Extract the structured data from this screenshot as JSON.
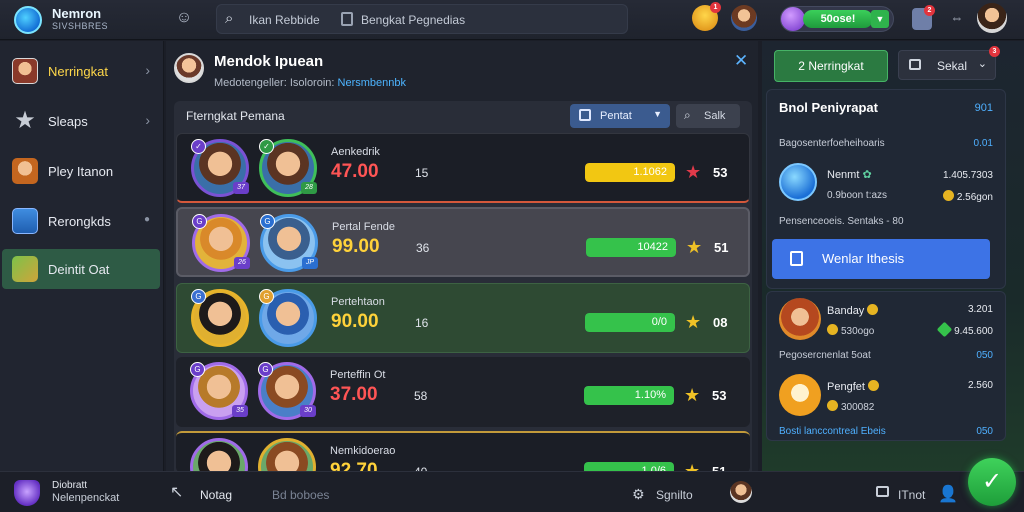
{
  "header": {
    "logo_title": "Nemron",
    "logo_subtitle": "SIVSHBRES",
    "search_label": "Ikan Rebbide",
    "search_secondary": "Bengkat Pegnedias",
    "gem_value": "50ose!",
    "badges": [
      "1",
      "2",
      "3"
    ]
  },
  "sidebar": {
    "items": [
      {
        "label": "Nerringkat",
        "icon": "hero-portrait-icon",
        "has_arrow": true
      },
      {
        "label": "Sleaps",
        "icon": "star-icon",
        "has_arrow": true
      },
      {
        "label": "Pley Itanon",
        "icon": "character-icon",
        "has_arrow": false
      },
      {
        "label": "Rerongkds",
        "icon": "screen-icon",
        "has_arrow": false
      },
      {
        "label": "Deintit Oat",
        "icon": "map-icon",
        "has_arrow": false
      }
    ]
  },
  "main": {
    "title": "Mendok Ipuean",
    "subtitle_plain": "Medotengeller: Isoloroin:",
    "subtitle_link": "Nersmbennbk",
    "panel_title": "Fterngkat Pemana",
    "filter_label": "Pentat",
    "search_label": "Salk",
    "rows": [
      {
        "label": "Aenkedrik",
        "score": "47.00",
        "num": "15",
        "bar_text": "1.1062",
        "bar_fraction": 1.0,
        "bar_color": "#f2c712",
        "star": "red-star-icon",
        "rank": "53",
        "score_color": "#ff5555"
      },
      {
        "label": "Pertal Fende",
        "score": "99.00",
        "num": "36",
        "bar_text": "10422",
        "bar_fraction": 1.0,
        "bar_color": "#35c24b",
        "star": "gold-star-icon",
        "rank": "51",
        "score_color": "#ffd23a"
      },
      {
        "label": "Pertehtaon",
        "score": "90.00",
        "num": "16",
        "bar_text": "0/0",
        "bar_fraction": 1.0,
        "bar_color": "#35c24b",
        "star": "gold-star-icon",
        "rank": "08",
        "score_color": "#ffd23a"
      },
      {
        "label": "Perteffin Ot",
        "score": "37.00",
        "num": "58",
        "bar_text": "1.10%",
        "bar_fraction": 1.0,
        "bar_color": "#35c24b",
        "star": "gold-star-icon",
        "rank": "53",
        "score_color": "#ff5555"
      },
      {
        "label": "Nemkidoerao",
        "score": "92.70",
        "num": "40",
        "bar_text": "1.0/6",
        "bar_fraction": 1.0,
        "bar_color": "#35c24b",
        "star": "gold-star-icon",
        "rank": "51",
        "score_color": "#ffd23a"
      }
    ]
  },
  "right": {
    "tab_active": "Nerringkat",
    "tab_active_num": "2",
    "tab_other": "Sekal",
    "card1": {
      "title": "Bnol Peniyrapat",
      "title_value": "901",
      "line1": "Bagosenterfoeheihoaris",
      "line1_value": "0.01",
      "name": "Nenmt",
      "name_value": "1.405.7303",
      "sub": "0.9boon t:azs",
      "sub_value": "2.56gon",
      "footer": "Pensenceoeis. Sentaks - 80"
    },
    "button_label": "Wenlar Ithesis",
    "card2": {
      "p1_name": "Banday",
      "p1_value": "3.201",
      "p1_sub": "530ogo",
      "p1_sub_value": "9.45.600",
      "line": "Pegosercnenlat 5oat",
      "line_value": "050",
      "p2_name": "Pengfet",
      "p2_value": "2.560",
      "p2_sub": "300082",
      "footer": "Bosti lanccontreal Ebeis",
      "footer_value": "050"
    }
  },
  "bottom": {
    "profile_line1": "Diobratt",
    "profile_line2": "Nelenpenckat",
    "nav_label": "Notag",
    "link_label": "Bd boboes",
    "settings_label": "Sgnilto",
    "trophy_label": "ITnot"
  },
  "colors": {
    "accent_green": "#2b7a41",
    "accent_blue": "#3d73e6",
    "link_blue": "#4fb0ff"
  }
}
